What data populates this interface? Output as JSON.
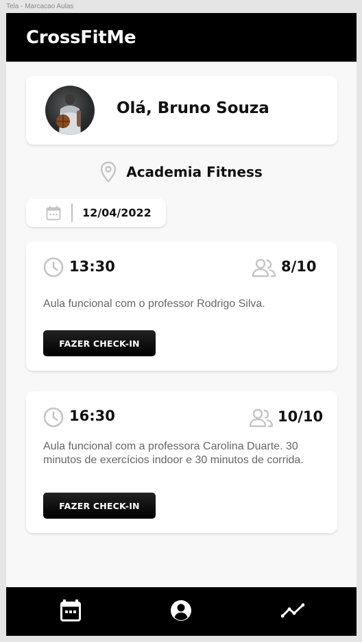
{
  "window_label": "Tela - Marcacao Aulas",
  "app": {
    "title": "CrossFitMe"
  },
  "profile": {
    "greeting": "Olá, Bruno Souza"
  },
  "location": {
    "name": "Academia Fitness",
    "icon": "map-pin-icon"
  },
  "date": {
    "value": "12/04/2022",
    "icon": "calendar-icon"
  },
  "classes": [
    {
      "time": "13:30",
      "occupancy": "8/10",
      "description": "Aula funcional com o professor Rodrigo Silva.",
      "button_label": "FAZER CHECK-IN"
    },
    {
      "time": "16:30",
      "occupancy": "10/10",
      "description": "Aula funcional com a professora Carolina Duarte. 30 minutos de exercícios indoor e 30 minutos de corrida.",
      "button_label": "FAZER CHECK-IN"
    }
  ],
  "bottom_nav": {
    "items": [
      {
        "icon": "calendar-icon"
      },
      {
        "icon": "user-circle-icon"
      },
      {
        "icon": "chart-line-icon"
      }
    ]
  },
  "colors": {
    "header_bg": "#000000",
    "page_bg": "#f8f8f8",
    "card_bg": "#ffffff",
    "icon_gray": "#c4c4c4",
    "description_text": "#666666"
  }
}
